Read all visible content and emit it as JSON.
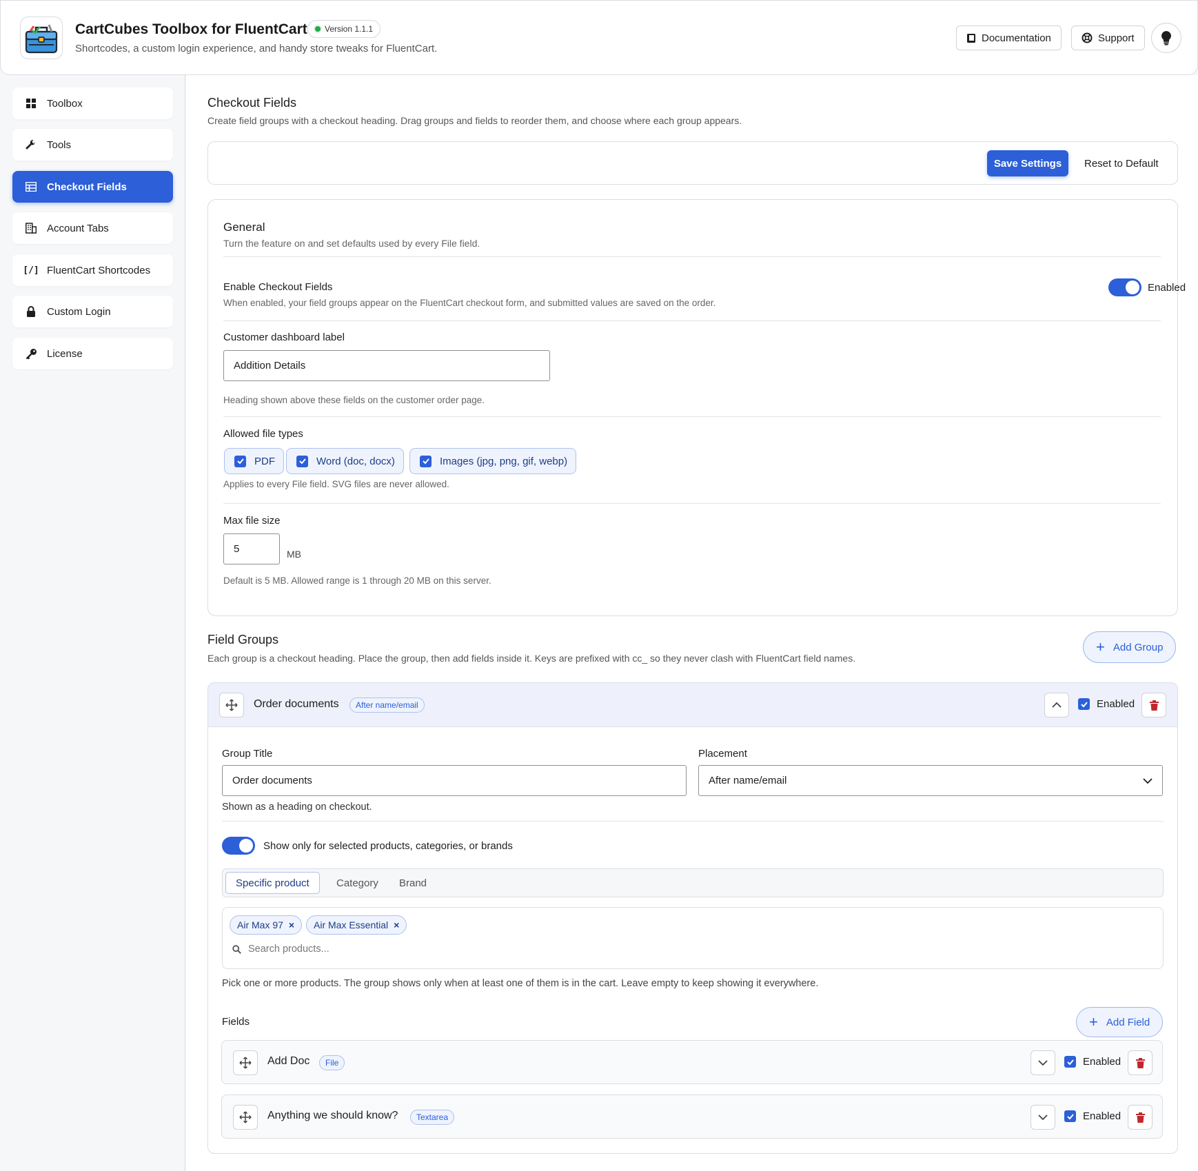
{
  "header": {
    "title": "CartCubes Toolbox for FluentCart",
    "version": "Version 1.1.1",
    "subtitle": "Shortcodes, a custom login experience, and handy store tweaks for FluentCart.",
    "docs_label": "Documentation",
    "support_label": "Support",
    "status_color": "#22a94b"
  },
  "sidebar": {
    "items": [
      {
        "label": "Toolbox",
        "icon": "grid-icon",
        "active": false
      },
      {
        "label": "Tools",
        "icon": "wrench-icon",
        "active": false
      },
      {
        "label": "Checkout Fields",
        "icon": "table-icon",
        "active": true
      },
      {
        "label": "Account Tabs",
        "icon": "building-icon",
        "active": false
      },
      {
        "label": "FluentCart Shortcodes",
        "icon": "shortcode-icon",
        "active": false
      },
      {
        "label": "Custom Login",
        "icon": "lock-icon",
        "active": false
      },
      {
        "label": "License",
        "icon": "key-icon",
        "active": false
      }
    ]
  },
  "page": {
    "title": "Checkout Fields",
    "description": "Create field groups with a checkout heading. Drag groups and fields to reorder them, and choose where each group appears.",
    "save_label": "Save Settings",
    "reset_label": "Reset to Default",
    "accent": "#2c5fd8"
  },
  "general": {
    "title": "General",
    "description": "Turn the feature on and set defaults used by every File field.",
    "enable_label": "Enable Checkout Fields",
    "enable_help": "When enabled, your field groups appear on the FluentCart checkout form, and submitted values are saved on the order.",
    "enable_state": "Enabled",
    "dashboard_label": "Customer dashboard label",
    "dashboard_value": "Addition Details",
    "dashboard_help": "Heading shown above these fields on the customer order page.",
    "file_types_label": "Allowed file types",
    "file_types": [
      "PDF",
      "Word (doc, docx)",
      "Images (jpg, png, gif, webp)"
    ],
    "file_types_help": "Applies to every File field. SVG files are never allowed.",
    "max_size_label": "Max file size",
    "max_size_value": "5",
    "max_size_unit": "MB",
    "max_size_help": "Default is 5 MB. Allowed range is 1 through 20 MB on this server."
  },
  "field_groups": {
    "title": "Field Groups",
    "description": "Each group is a checkout heading. Place the group, then add fields inside it. Keys are prefixed with cc_ so they never clash with FluentCart field names.",
    "add_group_label": "Add Group",
    "group": {
      "name": "Order documents",
      "placement_tag": "After name/email",
      "enabled_label": "Enabled",
      "group_title_label": "Group Title",
      "group_title_value": "Order documents",
      "group_title_help": "Shown as a heading on checkout.",
      "placement_label": "Placement",
      "placement_value": "After name/email",
      "restrict_label": "Show only for selected products, categories, or brands",
      "tabs": [
        "Specific product",
        "Category",
        "Brand"
      ],
      "products": [
        "Air Max 97",
        "Air Max Essential"
      ],
      "search_placeholder": "Search products...",
      "products_help": "Pick one or more products. The group shows only when at least one of them is in the cart. Leave empty to keep showing it everywhere.",
      "fields_label": "Fields",
      "add_field_label": "Add Field",
      "fields": [
        {
          "name": "Add Doc",
          "type": "File",
          "enabled_label": "Enabled"
        },
        {
          "name": "Anything we should know?",
          "type": "Textarea",
          "enabled_label": "Enabled"
        }
      ]
    }
  }
}
